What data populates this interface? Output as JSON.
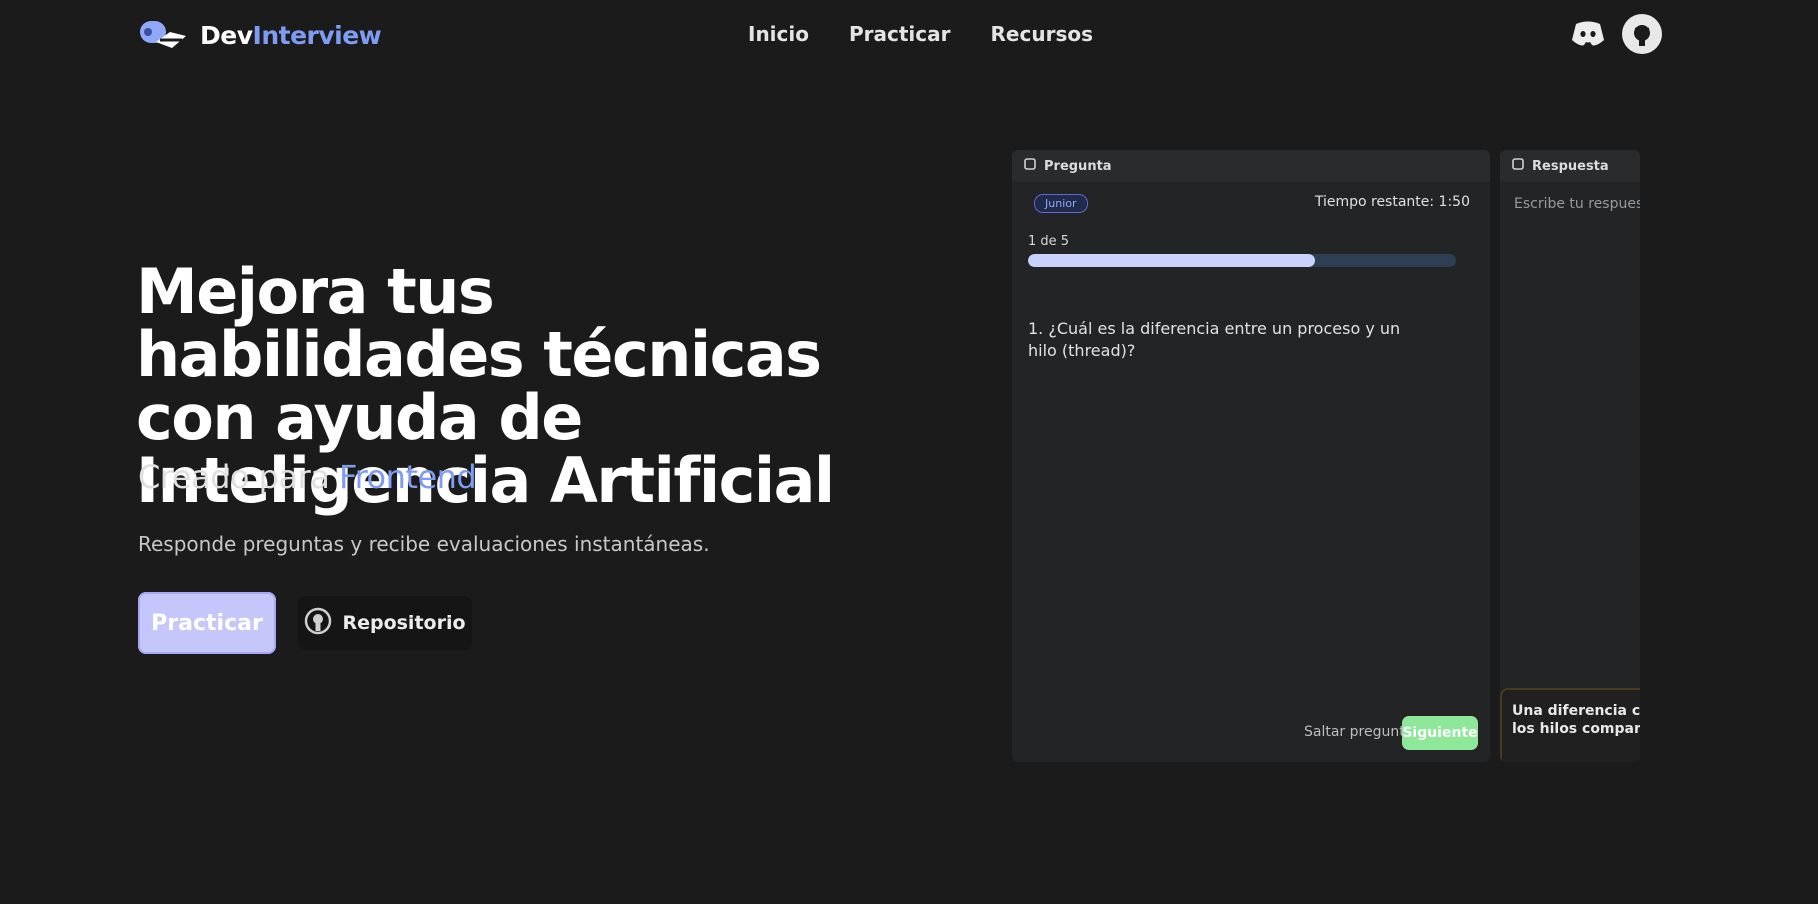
{
  "brand": {
    "name_part1": "Dev",
    "name_part2": "Interview",
    "accent_color": "#7f9cf5"
  },
  "nav": {
    "links": [
      "Inicio",
      "Practicar",
      "Recursos"
    ]
  },
  "header_icons": [
    "discord-icon",
    "github-icon"
  ],
  "hero": {
    "title": "Mejora tus habilidades técnicas con ayuda de Inteligencia Artificial",
    "subtitle_prefix": "Creado para",
    "subtitle_accent": "Frontend",
    "description": "Responde preguntas y recibe evaluaciones instantáneas.",
    "primary_button": "Practicar",
    "secondary_button": "Repositorio"
  },
  "preview": {
    "question_panel_title": "Pregunta",
    "level_badge": "Junior",
    "time_left": "Tiempo restante: 1:50",
    "question_counter": "1 de 5",
    "progress_fraction": 0.67,
    "question_text": "1. ¿Cuál es la diferencia entre un proceso y un hilo (thread)?",
    "skip_label": "Saltar pregunta",
    "next_button": "Siguiente",
    "answer_panel_title": "Respuesta",
    "answer_placeholder": "Escribe tu respuesta aquí...",
    "hint_line1": "Una diferencia clave es que",
    "hint_line2": "los hilos comparten memoria"
  },
  "colors": {
    "background": "#1b1b1b",
    "primary_button": "#c5c7fb",
    "next_button": "#8ee89a",
    "progress": "#c8d2fb"
  }
}
